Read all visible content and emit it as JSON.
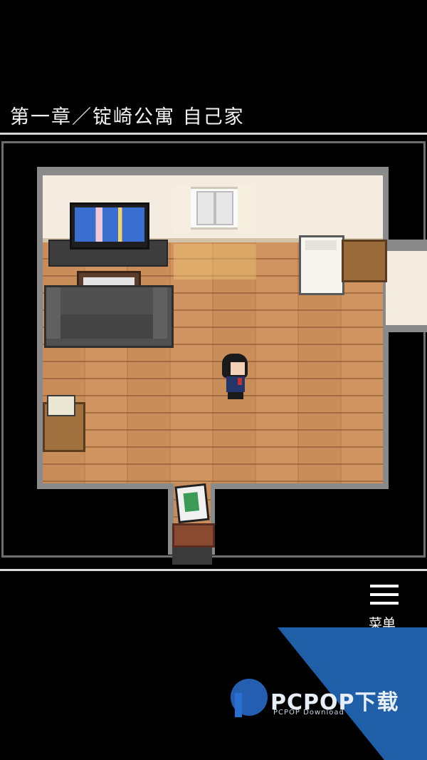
{
  "header": {
    "chapter_title": "第一章／锭崎公寓 自己家"
  },
  "menu": {
    "label": "菜单",
    "icon": "hamburger-menu-icon"
  },
  "watermark": {
    "brand": "PCPOP下载",
    "subtitle": "PCPOP Download",
    "color": "#1e5fa8"
  },
  "colors": {
    "background": "#000000",
    "floor": "#c98d5a",
    "wall": "#f4ece0",
    "frame": "#7a7a7a"
  }
}
